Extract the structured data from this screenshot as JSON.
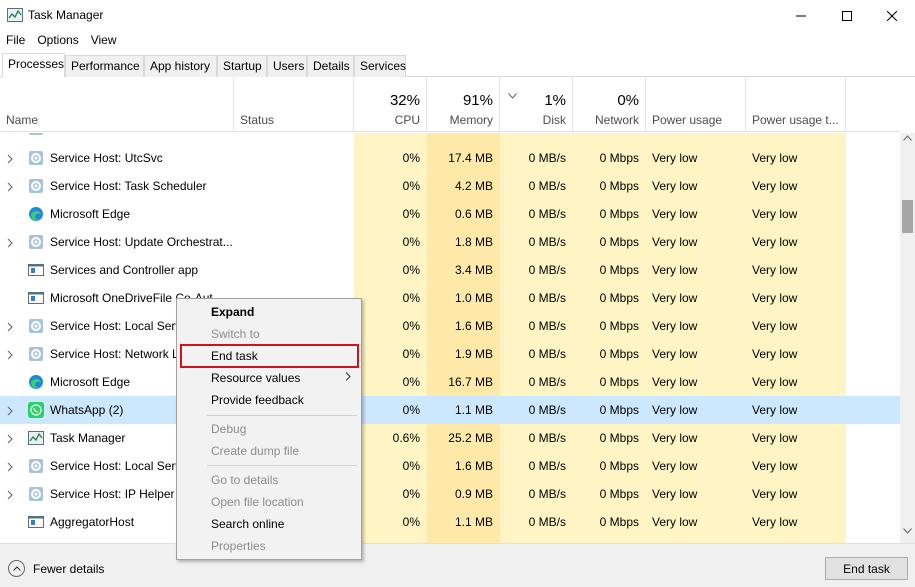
{
  "window": {
    "title": "Task Manager",
    "icon": "task-manager-icon"
  },
  "menu": [
    "File",
    "Options",
    "View"
  ],
  "tabs": [
    "Processes",
    "Performance",
    "App history",
    "Startup",
    "Users",
    "Details",
    "Services"
  ],
  "columns": {
    "name": "Name",
    "status": "Status",
    "cpu": {
      "pct": "32%",
      "label": "CPU"
    },
    "memory": {
      "pct": "91%",
      "label": "Memory"
    },
    "disk": {
      "pct": "1%",
      "label": "Disk"
    },
    "network": {
      "pct": "0%",
      "label": "Network"
    },
    "power": "Power usage",
    "power_trend": "Power usage t..."
  },
  "colors": {
    "cell_tint": "#fff4c4",
    "selected_row": "#cce8ff",
    "highlight_border": "#d0121b"
  },
  "rows": [
    {
      "name": "Service Host: UtcSvc",
      "icon": "gear-icon",
      "expandable": true,
      "cpu": "0%",
      "memory": "17.4 MB",
      "disk": "0 MB/s",
      "network": "0 Mbps",
      "power": "Very low",
      "power_trend": "Very low"
    },
    {
      "name": "Service Host: Task Scheduler",
      "icon": "gear-icon",
      "expandable": true,
      "cpu": "0%",
      "memory": "4.2 MB",
      "disk": "0 MB/s",
      "network": "0 Mbps",
      "power": "Very low",
      "power_trend": "Very low"
    },
    {
      "name": "Microsoft Edge",
      "icon": "edge-icon",
      "expandable": false,
      "cpu": "0%",
      "memory": "0.6 MB",
      "disk": "0 MB/s",
      "network": "0 Mbps",
      "power": "Very low",
      "power_trend": "Very low"
    },
    {
      "name": "Service Host: Update Orchestrat...",
      "icon": "gear-icon",
      "expandable": true,
      "cpu": "0%",
      "memory": "1.8 MB",
      "disk": "0 MB/s",
      "network": "0 Mbps",
      "power": "Very low",
      "power_trend": "Very low"
    },
    {
      "name": "Services and Controller app",
      "icon": "window-icon",
      "expandable": false,
      "cpu": "0%",
      "memory": "3.4 MB",
      "disk": "0 MB/s",
      "network": "0 Mbps",
      "power": "Very low",
      "power_trend": "Very low"
    },
    {
      "name": "Microsoft OneDriveFile Co-Aut...",
      "icon": "window-icon",
      "expandable": false,
      "cpu": "0%",
      "memory": "1.0 MB",
      "disk": "0 MB/s",
      "network": "0 Mbps",
      "power": "Very low",
      "power_trend": "Very low"
    },
    {
      "name": "Service Host: Local Servi",
      "icon": "gear-icon",
      "expandable": true,
      "cpu": "0%",
      "memory": "1.6 MB",
      "disk": "0 MB/s",
      "network": "0 Mbps",
      "power": "Very low",
      "power_trend": "Very low"
    },
    {
      "name": "Service Host: Network L",
      "icon": "gear-icon",
      "expandable": true,
      "cpu": "0%",
      "memory": "1.9 MB",
      "disk": "0 MB/s",
      "network": "0 Mbps",
      "power": "Very low",
      "power_trend": "Very low"
    },
    {
      "name": "Microsoft Edge",
      "icon": "edge-icon",
      "expandable": false,
      "cpu": "0%",
      "memory": "16.7 MB",
      "disk": "0 MB/s",
      "network": "0 Mbps",
      "power": "Very low",
      "power_trend": "Very low"
    },
    {
      "name": "WhatsApp (2)",
      "icon": "whatsapp-icon",
      "expandable": true,
      "selected": true,
      "cpu": "0%",
      "memory": "1.1 MB",
      "disk": "0 MB/s",
      "network": "0 Mbps",
      "power": "Very low",
      "power_trend": "Very low"
    },
    {
      "name": "Task Manager",
      "icon": "task-manager-icon",
      "expandable": true,
      "cpu": "0.6%",
      "memory": "25.2 MB",
      "disk": "0 MB/s",
      "network": "0 Mbps",
      "power": "Very low",
      "power_trend": "Very low"
    },
    {
      "name": "Service Host: Local Servi",
      "icon": "gear-icon",
      "expandable": true,
      "cpu": "0%",
      "memory": "1.6 MB",
      "disk": "0 MB/s",
      "network": "0 Mbps",
      "power": "Very low",
      "power_trend": "Very low"
    },
    {
      "name": "Service Host: IP Helper",
      "icon": "gear-icon",
      "expandable": true,
      "cpu": "0%",
      "memory": "0.9 MB",
      "disk": "0 MB/s",
      "network": "0 Mbps",
      "power": "Very low",
      "power_trend": "Very low"
    },
    {
      "name": "AggregatorHost",
      "icon": "window-icon",
      "expandable": false,
      "cpu": "0%",
      "memory": "1.1 MB",
      "disk": "0 MB/s",
      "network": "0 Mbps",
      "power": "Very low",
      "power_trend": "Very low"
    }
  ],
  "context_menu": {
    "items": [
      {
        "label": "Expand",
        "bold": true,
        "disabled": false
      },
      {
        "label": "Switch to",
        "disabled": true
      },
      {
        "label": "End task",
        "disabled": false,
        "highlighted": true
      },
      {
        "label": "Resource values",
        "disabled": false,
        "submenu": true
      },
      {
        "label": "Provide feedback",
        "disabled": false
      },
      {
        "label": "Debug",
        "disabled": true
      },
      {
        "label": "Create dump file",
        "disabled": true
      },
      {
        "label": "Go to details",
        "disabled": true
      },
      {
        "label": "Open file location",
        "disabled": true
      },
      {
        "label": "Search online",
        "disabled": false
      },
      {
        "label": "Properties",
        "disabled": true
      }
    ]
  },
  "footer": {
    "fewer_details": "Fewer details",
    "end_task": "End task"
  }
}
